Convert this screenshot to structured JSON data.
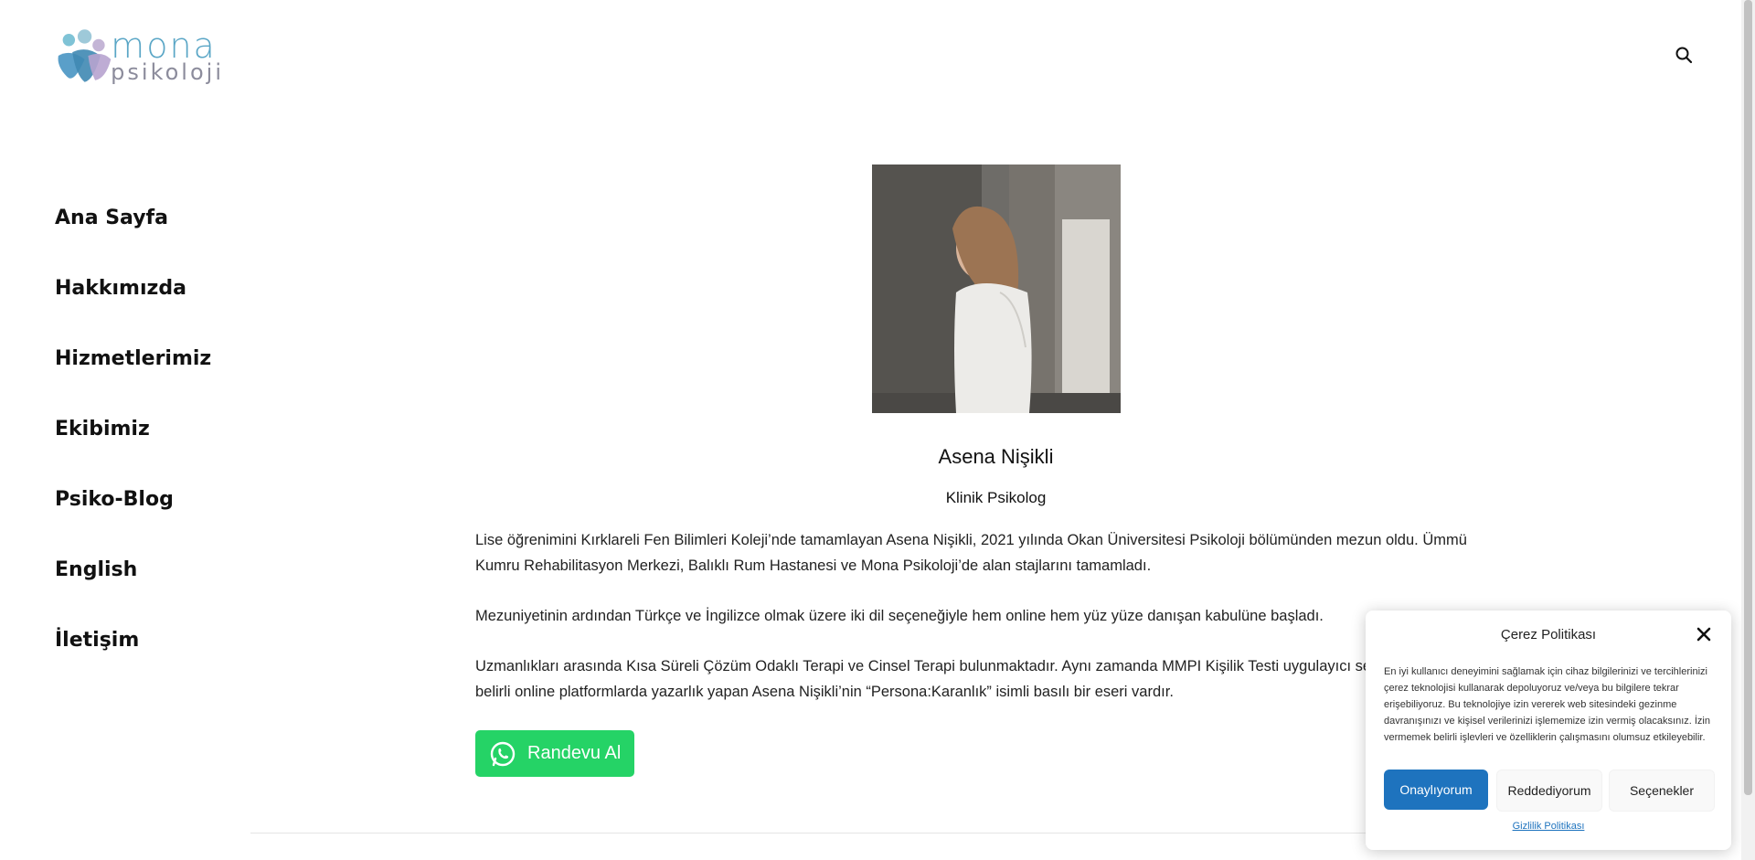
{
  "header": {
    "logo_name": "mona",
    "logo_sub": "psikoloji",
    "search_icon": "search-icon"
  },
  "nav": {
    "items": [
      {
        "label": "Ana Sayfa"
      },
      {
        "label": "Hakkımızda"
      },
      {
        "label": "Hizmetlerimiz"
      },
      {
        "label": "Ekibimiz"
      },
      {
        "label": "Psiko-Blog"
      },
      {
        "label": "English"
      },
      {
        "label": "İletişim"
      }
    ]
  },
  "profile": {
    "name": "Asena Nişikli",
    "title": "Klinik Psikolog",
    "bio": [
      "Lise öğrenimini Kırklareli Fen Bilimleri Koleji’nde tamamlayan Asena Nişikli, 2021 yılında Okan Üniversitesi Psikoloji bölümünden mezun oldu. Ümmü Kumru Rehabilitasyon Merkezi, Balıklı Rum Hastanesi ve Mona Psikoloji’de alan stajlarını tamamladı.",
      "Mezuniyetinin ardından Türkçe ve İngilizce olmak üzere iki dil seçeneğiyle hem online hem yüz yüze danışan kabulüne başladı.",
      "Uzmanlıkları arasında Kısa Süreli Çözüm Odaklı Terapi ve Cinsel Terapi bulunmaktadır. Aynı zamanda MMPI Kişilik Testi uygulayıcı sertifikas… yıldır belirli online platformlarda yazarlık yapan Asena Nişikli’nin “Persona:Karanlık” isimli basılı bir eseri vardır."
    ],
    "cta_label": "Randevu Al",
    "cta_icon": "whatsapp-icon"
  },
  "cookie": {
    "title": "Çerez Politikası",
    "text": "En iyi kullanıcı deneyimini sağlamak için cihaz bilgilerinizi ve tercihlerinizi çerez teknolojisi kullanarak depoluyoruz ve/veya bu bilgilere tekrar erişebiliyoruz. Bu teknolojiye izin vererek web sitesindeki gezinme davranışınızı ve kişisel verilerinizi işlememize izin vermiş olacaksınız. İzin vermemek belirli işlevleri ve özelliklerin çalışmasını olumsuz etkileyebilir.",
    "accept_label": "Onaylıyorum",
    "deny_label": "Reddediyorum",
    "options_label": "Seçenekler",
    "privacy_link": "Gizlilik Politikası"
  },
  "colors": {
    "accent": "#1e73be",
    "whatsapp": "#25d366",
    "logo_blue": "#5aa6c6",
    "logo_grey": "#8c8c9c"
  }
}
